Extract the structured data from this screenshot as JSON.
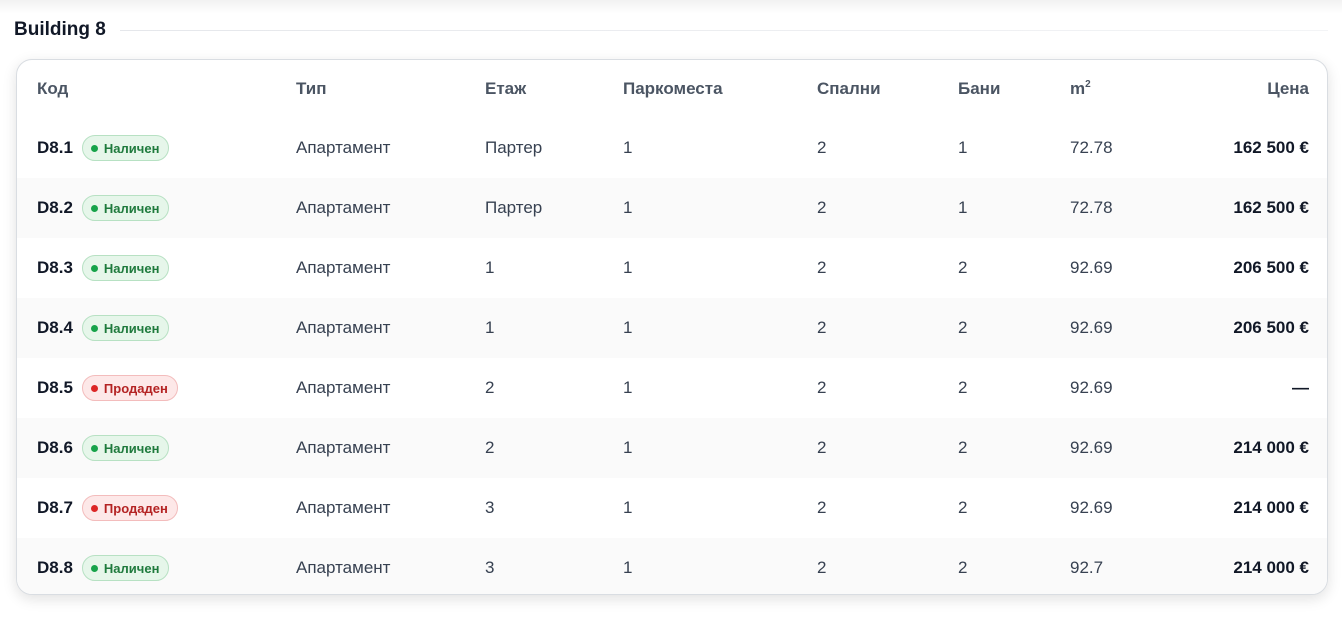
{
  "section": {
    "title": "Building 8"
  },
  "table": {
    "headers": {
      "code": "Код",
      "type": "Тип",
      "floor": "Етаж",
      "parking": "Паркоместа",
      "bedrooms": "Спални",
      "bathrooms": "Бани",
      "area_base": "m",
      "area_sup": "2",
      "price": "Цена"
    },
    "rows": [
      {
        "code": "D8.1",
        "status": "Наличен",
        "status_type": "available",
        "type": "Апартамент",
        "floor": "Партер",
        "parking": "1",
        "bedrooms": "2",
        "bathrooms": "1",
        "area": "72.78",
        "price": "162 500 €"
      },
      {
        "code": "D8.2",
        "status": "Наличен",
        "status_type": "available",
        "type": "Апартамент",
        "floor": "Партер",
        "parking": "1",
        "bedrooms": "2",
        "bathrooms": "1",
        "area": "72.78",
        "price": "162 500 €"
      },
      {
        "code": "D8.3",
        "status": "Наличен",
        "status_type": "available",
        "type": "Апартамент",
        "floor": "1",
        "parking": "1",
        "bedrooms": "2",
        "bathrooms": "2",
        "area": "92.69",
        "price": "206 500 €"
      },
      {
        "code": "D8.4",
        "status": "Наличен",
        "status_type": "available",
        "type": "Апартамент",
        "floor": "1",
        "parking": "1",
        "bedrooms": "2",
        "bathrooms": "2",
        "area": "92.69",
        "price": "206 500 €"
      },
      {
        "code": "D8.5",
        "status": "Продаден",
        "status_type": "sold",
        "type": "Апартамент",
        "floor": "2",
        "parking": "1",
        "bedrooms": "2",
        "bathrooms": "2",
        "area": "92.69",
        "price": "—"
      },
      {
        "code": "D8.6",
        "status": "Наличен",
        "status_type": "available",
        "type": "Апартамент",
        "floor": "2",
        "parking": "1",
        "bedrooms": "2",
        "bathrooms": "2",
        "area": "92.69",
        "price": "214 000 €"
      },
      {
        "code": "D8.7",
        "status": "Продаден",
        "status_type": "sold",
        "type": "Апартамент",
        "floor": "3",
        "parking": "1",
        "bedrooms": "2",
        "bathrooms": "2",
        "area": "92.69",
        "price": "214 000 €"
      },
      {
        "code": "D8.8",
        "status": "Наличен",
        "status_type": "available",
        "type": "Апартамент",
        "floor": "3",
        "parking": "1",
        "bedrooms": "2",
        "bathrooms": "2",
        "area": "92.7",
        "price": "214 000 €"
      }
    ]
  },
  "colors": {
    "available_badge": "#e6f6ea",
    "available_text": "#1f7a3d",
    "sold_badge": "#fde8e8",
    "sold_text": "#b42323",
    "row_alt": "#fafafa"
  }
}
